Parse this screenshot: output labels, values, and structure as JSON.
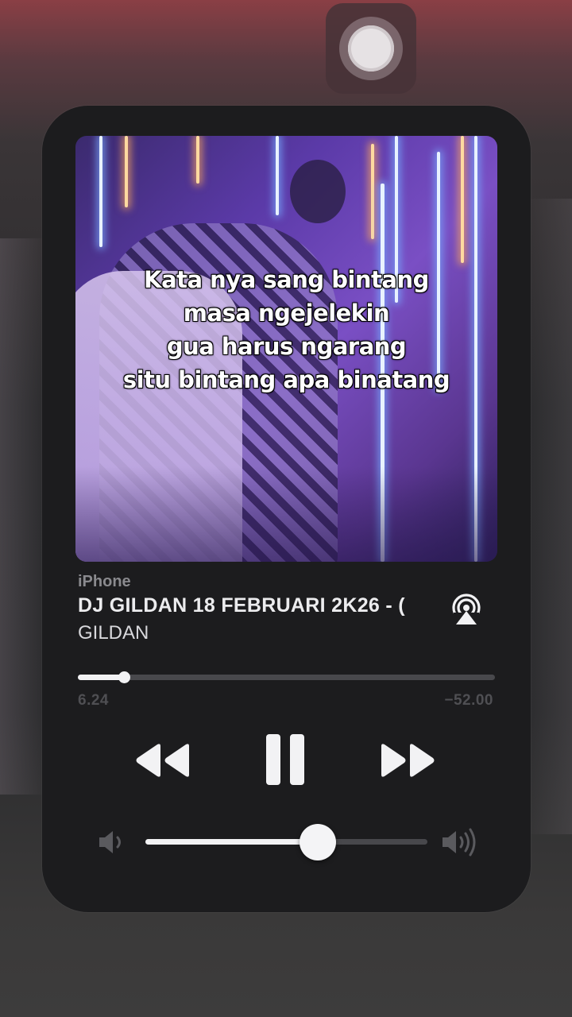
{
  "now_playing": {
    "device": "iPhone",
    "title": "DJ GILDAN 18 FEBRUARI 2K26 - (",
    "artist": "GILDAN",
    "progress_fraction": 0.11,
    "time_elapsed": "6.24",
    "time_remaining": "−52.00",
    "volume_fraction": 0.61
  },
  "lyrics": {
    "lines": [
      "Kata nya sang bintang",
      "masa ngejelekin",
      "gua harus ngarang",
      "situ bintang apa binatang"
    ]
  },
  "controls": {
    "rewind_icon": "rewind-icon",
    "pause_icon": "pause-icon",
    "forward_icon": "fast-forward-icon",
    "airplay_icon": "airplay-icon",
    "volume_low_icon": "speaker-low-icon",
    "volume_high_icon": "speaker-high-icon",
    "record_icon": "screen-record-icon"
  },
  "colors": {
    "card_bg": "#1c1c1e",
    "accent": "#f2f2f4",
    "muted_text": "#8a8a8e",
    "track": "#48484c"
  }
}
